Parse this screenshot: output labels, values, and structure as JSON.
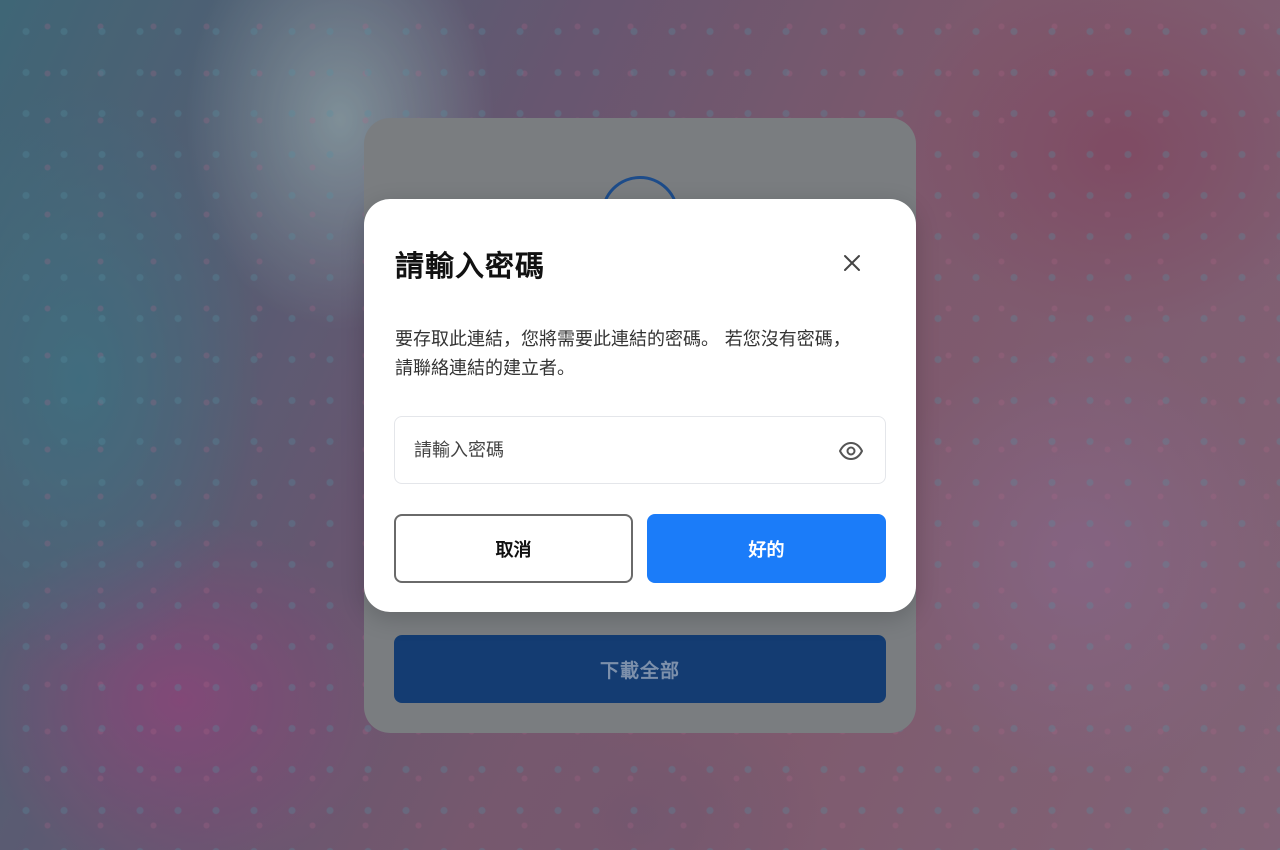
{
  "background_card": {
    "download_all_label": "下載全部"
  },
  "dialog": {
    "title": "請輸入密碼",
    "description": "要存取此連結，您將需要此連結的密碼。 若您沒有密碼，請聯絡連結的建立者。",
    "password_placeholder": "請輸入密碼",
    "password_value": "",
    "cancel_label": "取消",
    "ok_label": "好的"
  },
  "icons": {
    "close": "close-icon",
    "show_password": "eye-icon"
  },
  "colors": {
    "primary": "#1b7cf9",
    "back_button": "#143c72",
    "ring": "#1d4c8a"
  }
}
